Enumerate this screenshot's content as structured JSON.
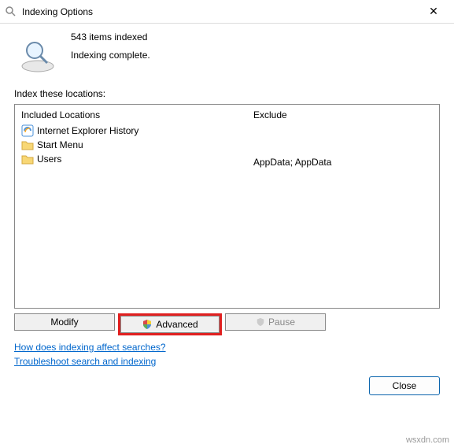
{
  "window": {
    "title": "Indexing Options",
    "close": "✕"
  },
  "status": {
    "count_line": "543 items indexed",
    "state_line": "Indexing complete."
  },
  "section_label": "Index these locations:",
  "columns": {
    "included_header": "Included Locations",
    "exclude_header": "Exclude"
  },
  "locations": [
    {
      "name": "Internet Explorer History",
      "icon": "ie",
      "exclude": ""
    },
    {
      "name": "Start Menu",
      "icon": "folder",
      "exclude": ""
    },
    {
      "name": "Users",
      "icon": "folder",
      "exclude": "AppData; AppData"
    }
  ],
  "buttons": {
    "modify": "Modify",
    "advanced": "Advanced",
    "pause": "Pause",
    "close": "Close"
  },
  "links": {
    "how": "How does indexing affect searches?",
    "troubleshoot": "Troubleshoot search and indexing"
  },
  "watermark": "wsxdn.com"
}
